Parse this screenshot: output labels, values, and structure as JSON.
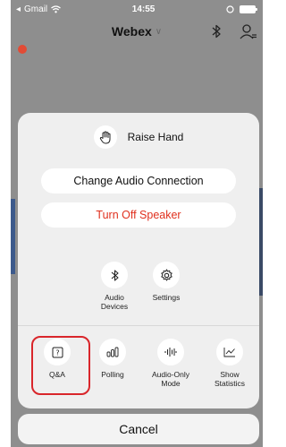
{
  "status": {
    "back_app": "Gmail",
    "time": "14:55"
  },
  "nav": {
    "title": "Webex"
  },
  "sheet": {
    "raise_hand": "Raise Hand",
    "change_audio": "Change Audio Connection",
    "turn_off_speaker": "Turn Off Speaker",
    "row1": [
      {
        "label": "Audio Devices",
        "icon": "bluetooth-icon"
      },
      {
        "label": "Settings",
        "icon": "settings-gear-icon"
      }
    ],
    "row2": [
      {
        "label": "Q&A",
        "icon": "question-icon"
      },
      {
        "label": "Polling",
        "icon": "polling-icon"
      },
      {
        "label": "Audio-Only Mode",
        "icon": "audio-wave-icon"
      },
      {
        "label": "Show Statistics",
        "icon": "statistics-icon"
      }
    ],
    "cancel": "Cancel"
  },
  "colors": {
    "accent_red": "#e0301e",
    "highlight": "#d9262b",
    "sheet_bg": "#efefef",
    "overlay_bg": "#8e8e8e"
  }
}
